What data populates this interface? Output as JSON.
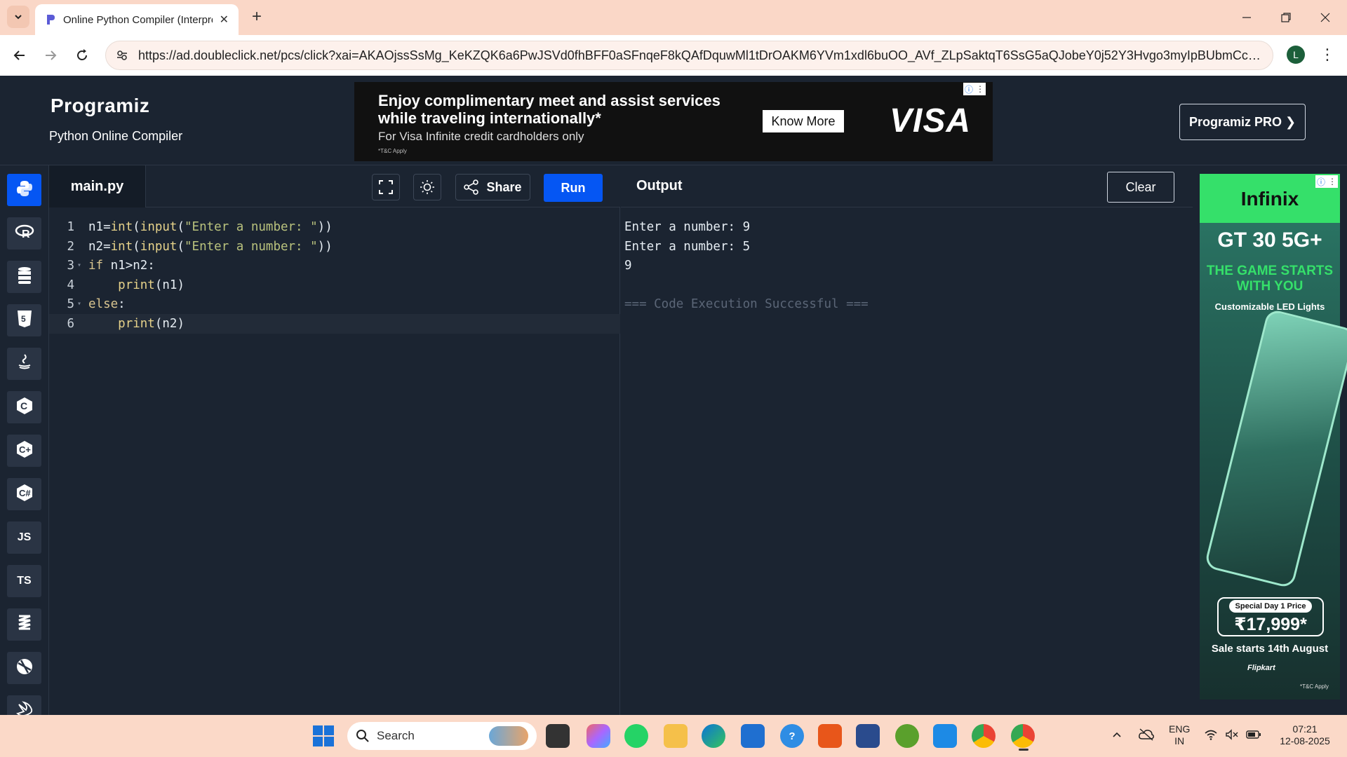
{
  "browser": {
    "tab_title": "Online Python Compiler (Interpreter)",
    "url": "https://ad.doubleclick.net/pcs/click?xai=AKAOjssSsMg_KeKZQK6a6PwJSVd0fhBFF0aSFnqeF8kQAfDquwMl1tDrOAKM6YVm1xdl6buOO_AVf_ZLpSaktqT6SsG5aQJobeY0j52Y3Hvgo3myIpBUbmCcUzrOlHbAaqz...",
    "profile_initial": "L"
  },
  "site": {
    "logo": "Programiz",
    "subtitle": "Python Online Compiler",
    "pro_button": "Programiz PRO ❯"
  },
  "top_ad": {
    "headline": "Enjoy complimentary meet and assist services while traveling internationally*",
    "sub": "For Visa Infinite credit cardholders only",
    "tc": "*T&C Apply",
    "button": "Know More",
    "brand": "VISA"
  },
  "sidebar": {
    "items": [
      {
        "label": "",
        "icon": "python-icon",
        "active": true
      },
      {
        "label": "",
        "icon": "r-icon"
      },
      {
        "label": "",
        "icon": "sql-icon"
      },
      {
        "label": "",
        "icon": "html-icon"
      },
      {
        "label": "",
        "icon": "java-icon"
      },
      {
        "label": "",
        "icon": "c-icon"
      },
      {
        "label": "",
        "icon": "cpp-icon"
      },
      {
        "label": "",
        "icon": "csharp-icon"
      },
      {
        "label": "JS",
        "icon": "js-icon"
      },
      {
        "label": "TS",
        "icon": "ts-icon"
      },
      {
        "label": "",
        "icon": "go-icon"
      },
      {
        "label": "",
        "icon": "php-icon"
      },
      {
        "label": "",
        "icon": "swift-icon"
      }
    ]
  },
  "editor": {
    "file_name": "main.py",
    "share_label": "Share",
    "run_label": "Run",
    "lines": [
      {
        "num": "1",
        "tokens": [
          [
            "plain",
            "n1"
          ],
          [
            "op",
            "="
          ],
          [
            "fn",
            "int"
          ],
          [
            "plain",
            "("
          ],
          [
            "fn",
            "input"
          ],
          [
            "plain",
            "("
          ],
          [
            "str",
            "\"Enter a number: \""
          ],
          [
            "plain",
            "))"
          ]
        ]
      },
      {
        "num": "2",
        "tokens": [
          [
            "plain",
            "n2"
          ],
          [
            "op",
            "="
          ],
          [
            "fn",
            "int"
          ],
          [
            "plain",
            "("
          ],
          [
            "fn",
            "input"
          ],
          [
            "plain",
            "("
          ],
          [
            "str",
            "\"Enter a number: \""
          ],
          [
            "plain",
            "))"
          ]
        ]
      },
      {
        "num": "3",
        "fold": true,
        "tokens": [
          [
            "kw",
            "if"
          ],
          [
            "plain",
            " n1"
          ],
          [
            "op",
            ">"
          ],
          [
            "plain",
            "n2:"
          ]
        ]
      },
      {
        "num": "4",
        "tokens": [
          [
            "plain",
            "    "
          ],
          [
            "fn",
            "print"
          ],
          [
            "plain",
            "(n1)"
          ]
        ]
      },
      {
        "num": "5",
        "fold": true,
        "tokens": [
          [
            "kw",
            "else"
          ],
          [
            "plain",
            ":"
          ]
        ]
      },
      {
        "num": "6",
        "current": true,
        "tokens": [
          [
            "plain",
            "    "
          ],
          [
            "fn",
            "print"
          ],
          [
            "plain",
            "(n2)"
          ]
        ]
      }
    ]
  },
  "output": {
    "title": "Output",
    "clear_label": "Clear",
    "lines": [
      {
        "text": "Enter a number: 9"
      },
      {
        "text": "Enter a number: 5"
      },
      {
        "text": "9"
      },
      {
        "text": ""
      },
      {
        "text": "=== Code Execution Successful ===",
        "dim": true
      }
    ]
  },
  "side_ad": {
    "brand": "Infinix",
    "model": "GT 30 5G+",
    "tagline": "THE GAME STARTS WITH YOU",
    "feature": "Customizable LED Lights",
    "price_label": "Special Day 1 Price",
    "price": "₹17,999*",
    "sale": "Sale starts 14th August",
    "partner": "Flipkart",
    "tc": "*T&C Apply"
  },
  "taskbar": {
    "search_label": "Search",
    "lang": "ENG",
    "region": "IN",
    "time": "07:21",
    "date": "12-08-2025"
  }
}
